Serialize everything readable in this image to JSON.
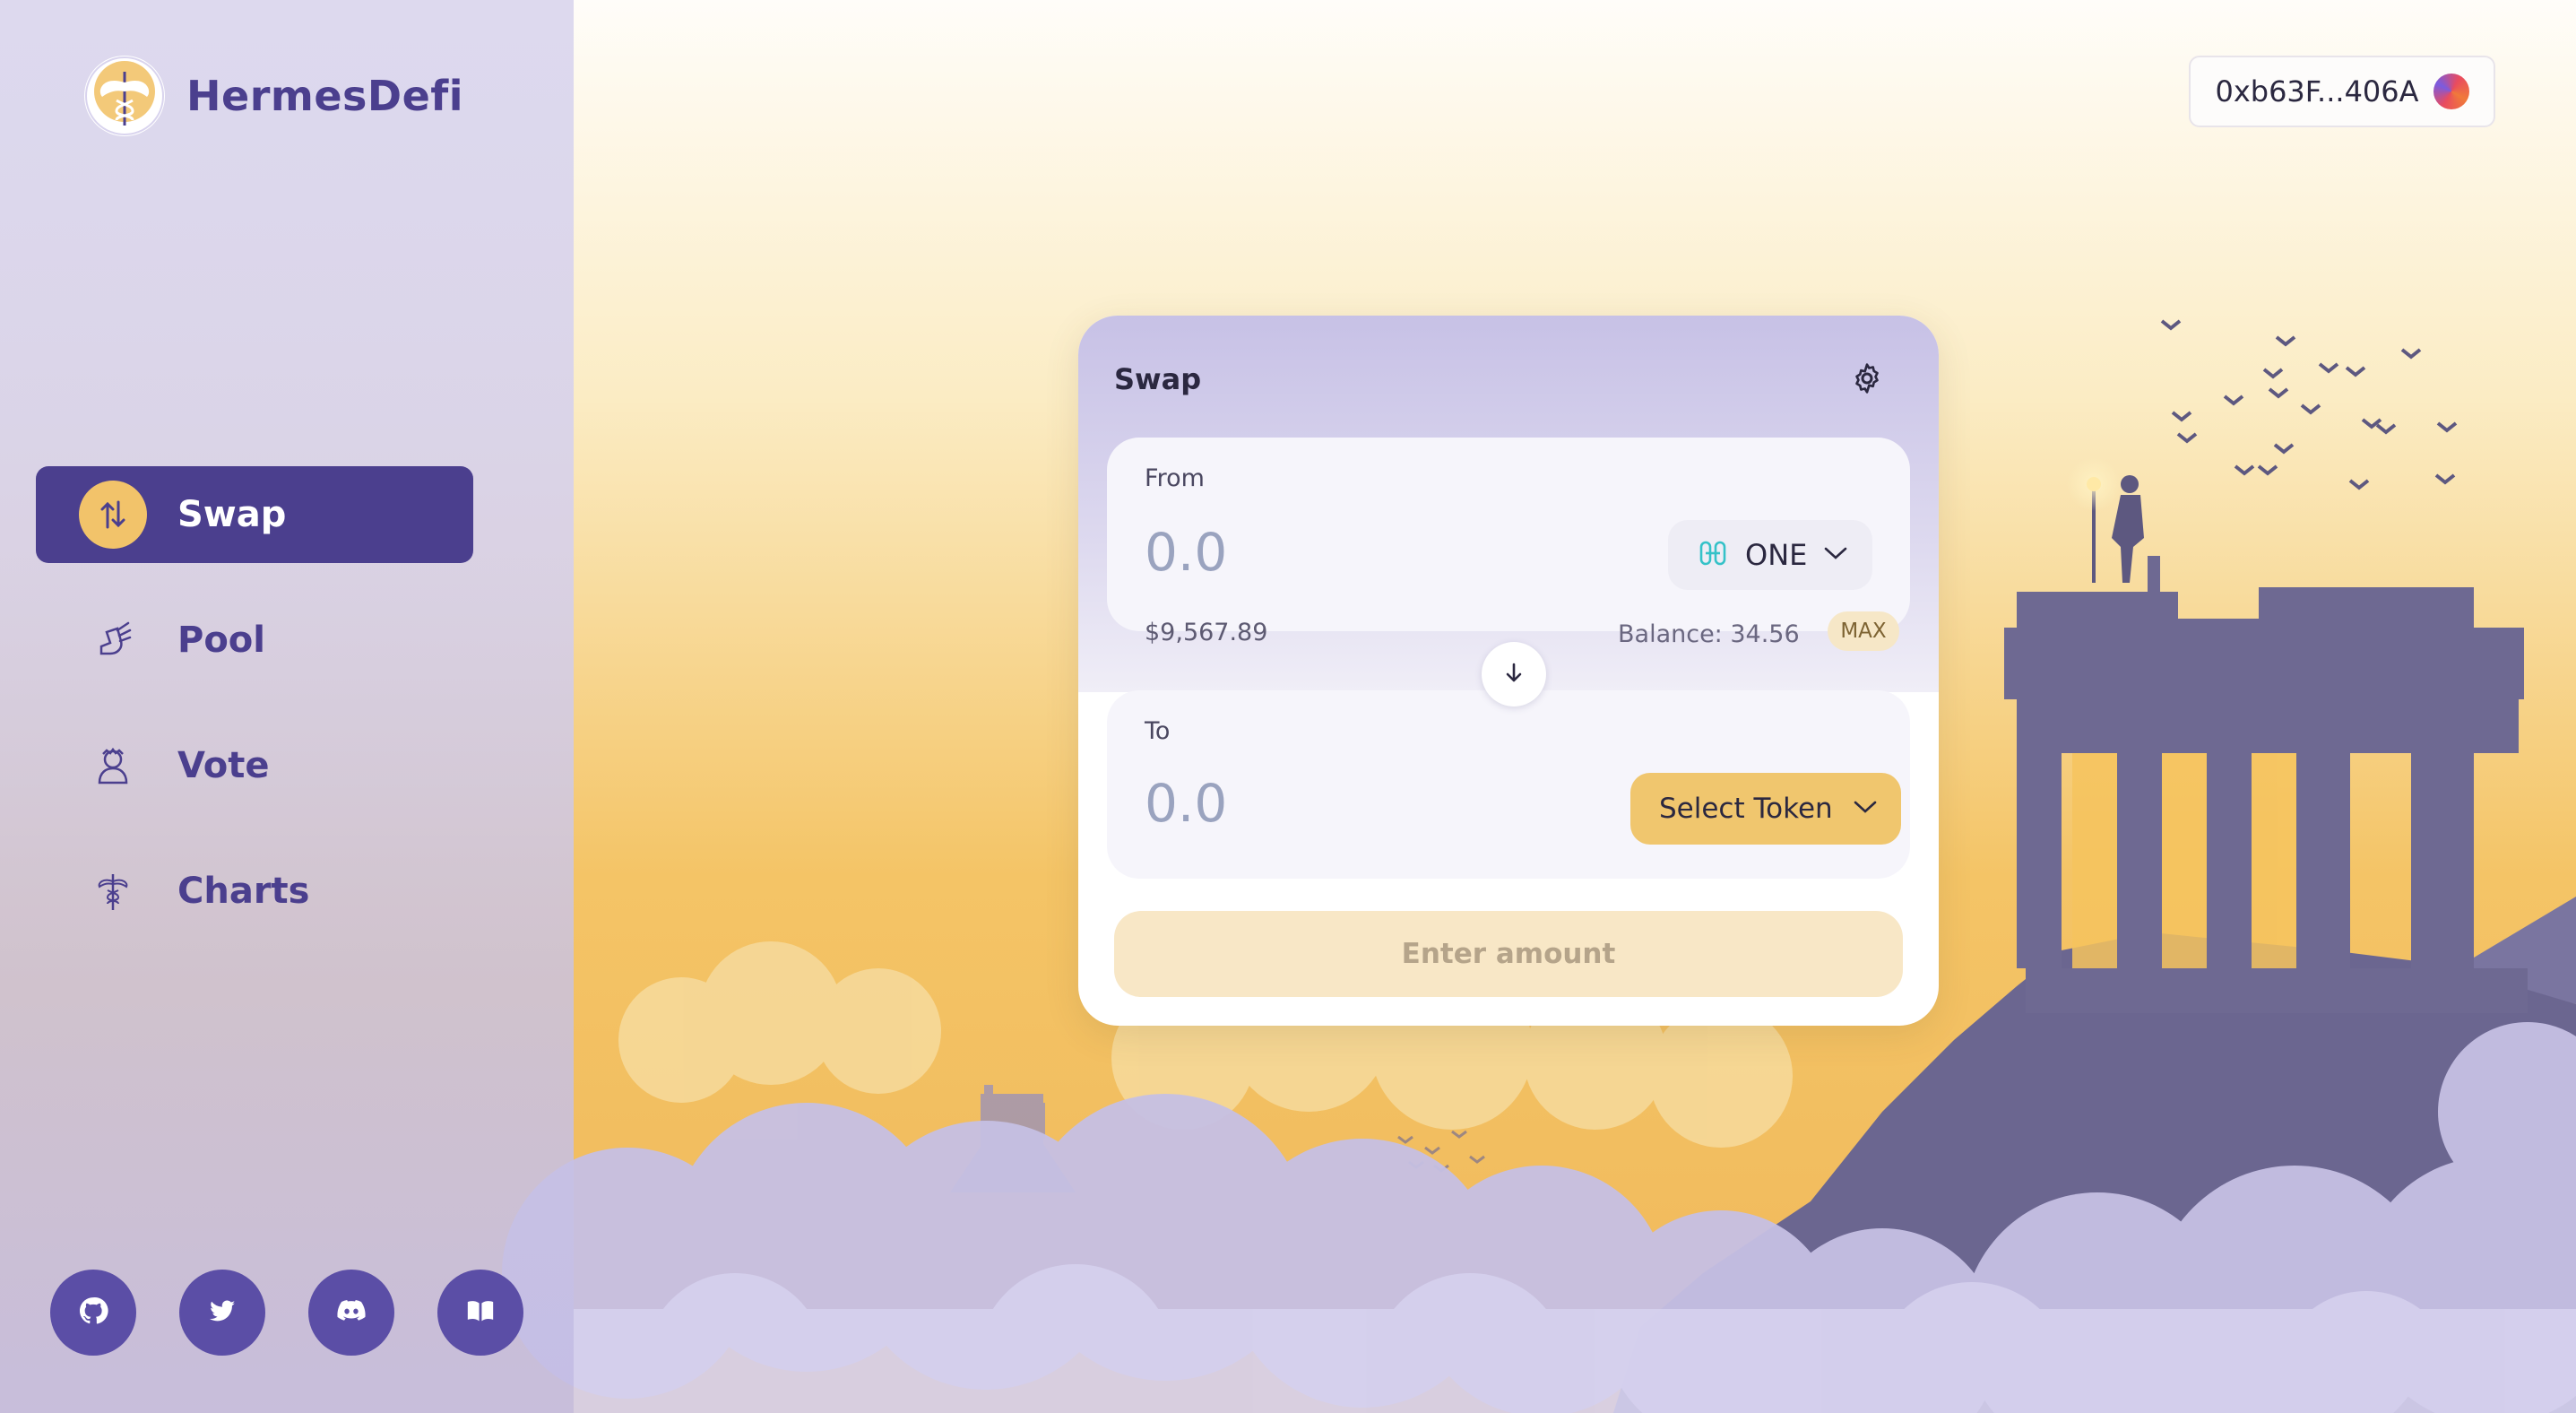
{
  "brand": {
    "name": "HermesDefi",
    "logo_icon": "caduceus-wings-icon"
  },
  "sidebar": {
    "items": [
      {
        "label": "Swap",
        "icon": "swap-arrows-icon",
        "active": true
      },
      {
        "label": "Pool",
        "icon": "winged-boot-icon",
        "active": false
      },
      {
        "label": "Vote",
        "icon": "greek-bust-icon",
        "active": false
      },
      {
        "label": "Charts",
        "icon": "caduceus-icon",
        "active": false
      }
    ],
    "socials": [
      {
        "name": "github",
        "icon": "github-icon"
      },
      {
        "name": "twitter",
        "icon": "twitter-icon"
      },
      {
        "name": "discord",
        "icon": "discord-icon"
      },
      {
        "name": "docs",
        "icon": "book-icon"
      }
    ]
  },
  "wallet": {
    "address": "0xb63F...406A",
    "avatar_icon": "wallet-avatar-icon"
  },
  "swap": {
    "title": "Swap",
    "from": {
      "label": "From",
      "amount_placeholder": "0.0",
      "token": "ONE",
      "usd_value": "$9,567.89",
      "balance": "Balance: 34.56",
      "max_label": "MAX"
    },
    "to": {
      "label": "To",
      "amount_placeholder": "0.0",
      "select_label": "Select Token"
    },
    "cta_label": "Enter amount"
  },
  "colors": {
    "accent": "#4b3f8e",
    "gold": "#f0c66e",
    "sky_top": "#fdfbf6",
    "sky_bottom": "#f5c466",
    "cloud": "#c9c3e6",
    "ruin": "#6b6690"
  }
}
